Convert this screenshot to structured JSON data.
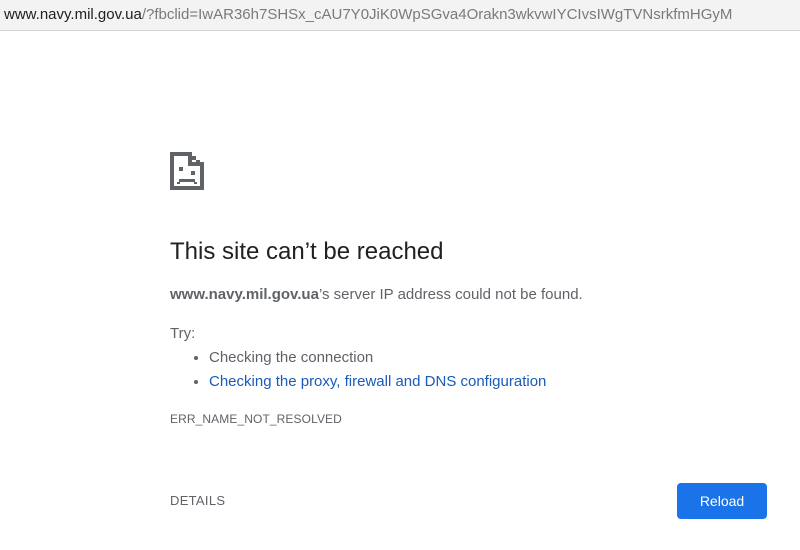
{
  "address_bar": {
    "host": "www.navy.mil.gov.ua",
    "rest": "/?fbclid=IwAR36h7SHSx_cAU7Y0JiK0WpSGva4Orakn3wkvwIYCIvsIWgTVNsrkfmHGyM"
  },
  "error_page": {
    "icon": "sad-document-icon",
    "heading": "This site can’t be reached",
    "summary_host": "www.navy.mil.gov.ua",
    "summary_text": "’s server IP address could not be found.",
    "try_label": "Try:",
    "suggestions": [
      "Checking the connection",
      "Checking the proxy, firewall and DNS configuration"
    ],
    "error_code": "ERR_NAME_NOT_RESOLVED",
    "details_label": "DETAILS",
    "reload_label": "Reload"
  },
  "colors": {
    "reload_button": "#1a73e8",
    "link": "#1a5ab8",
    "text": "#5f6368",
    "heading": "#202124"
  }
}
